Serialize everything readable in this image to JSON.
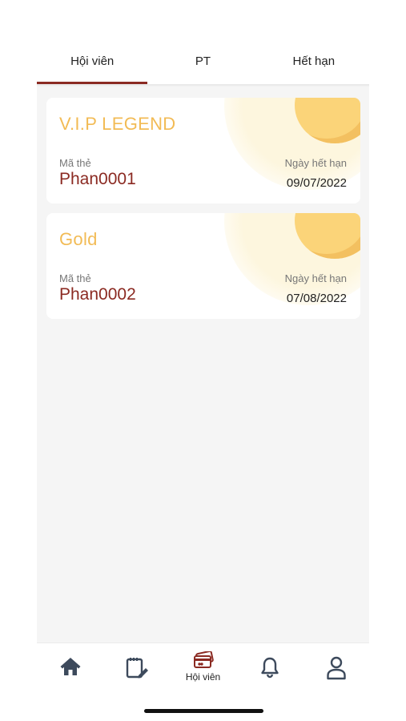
{
  "tabs": [
    {
      "label": "Hội viên",
      "active": true
    },
    {
      "label": "PT",
      "active": false
    },
    {
      "label": "Hết hạn",
      "active": false
    }
  ],
  "cards": [
    {
      "title": "V.I.P LEGEND",
      "code_label": "Mã thẻ",
      "code": "Phan0001",
      "expiry_label": "Ngày hết hạn",
      "expiry": "09/07/2022"
    },
    {
      "title": "Gold",
      "code_label": "Mã thẻ",
      "code": "Phan0002",
      "expiry_label": "Ngày hết hạn",
      "expiry": "07/08/2022"
    }
  ],
  "bottom_nav": {
    "items": [
      {
        "icon": "home-icon"
      },
      {
        "icon": "notebook-edit-icon"
      },
      {
        "icon": "membership-card-icon",
        "label": "Hội viên",
        "active": true
      },
      {
        "icon": "bell-icon"
      },
      {
        "icon": "user-icon"
      }
    ]
  },
  "colors": {
    "accent": "#8b2a22",
    "card_title": "#f2bb55",
    "nav_icon": "#3d4a5c"
  }
}
